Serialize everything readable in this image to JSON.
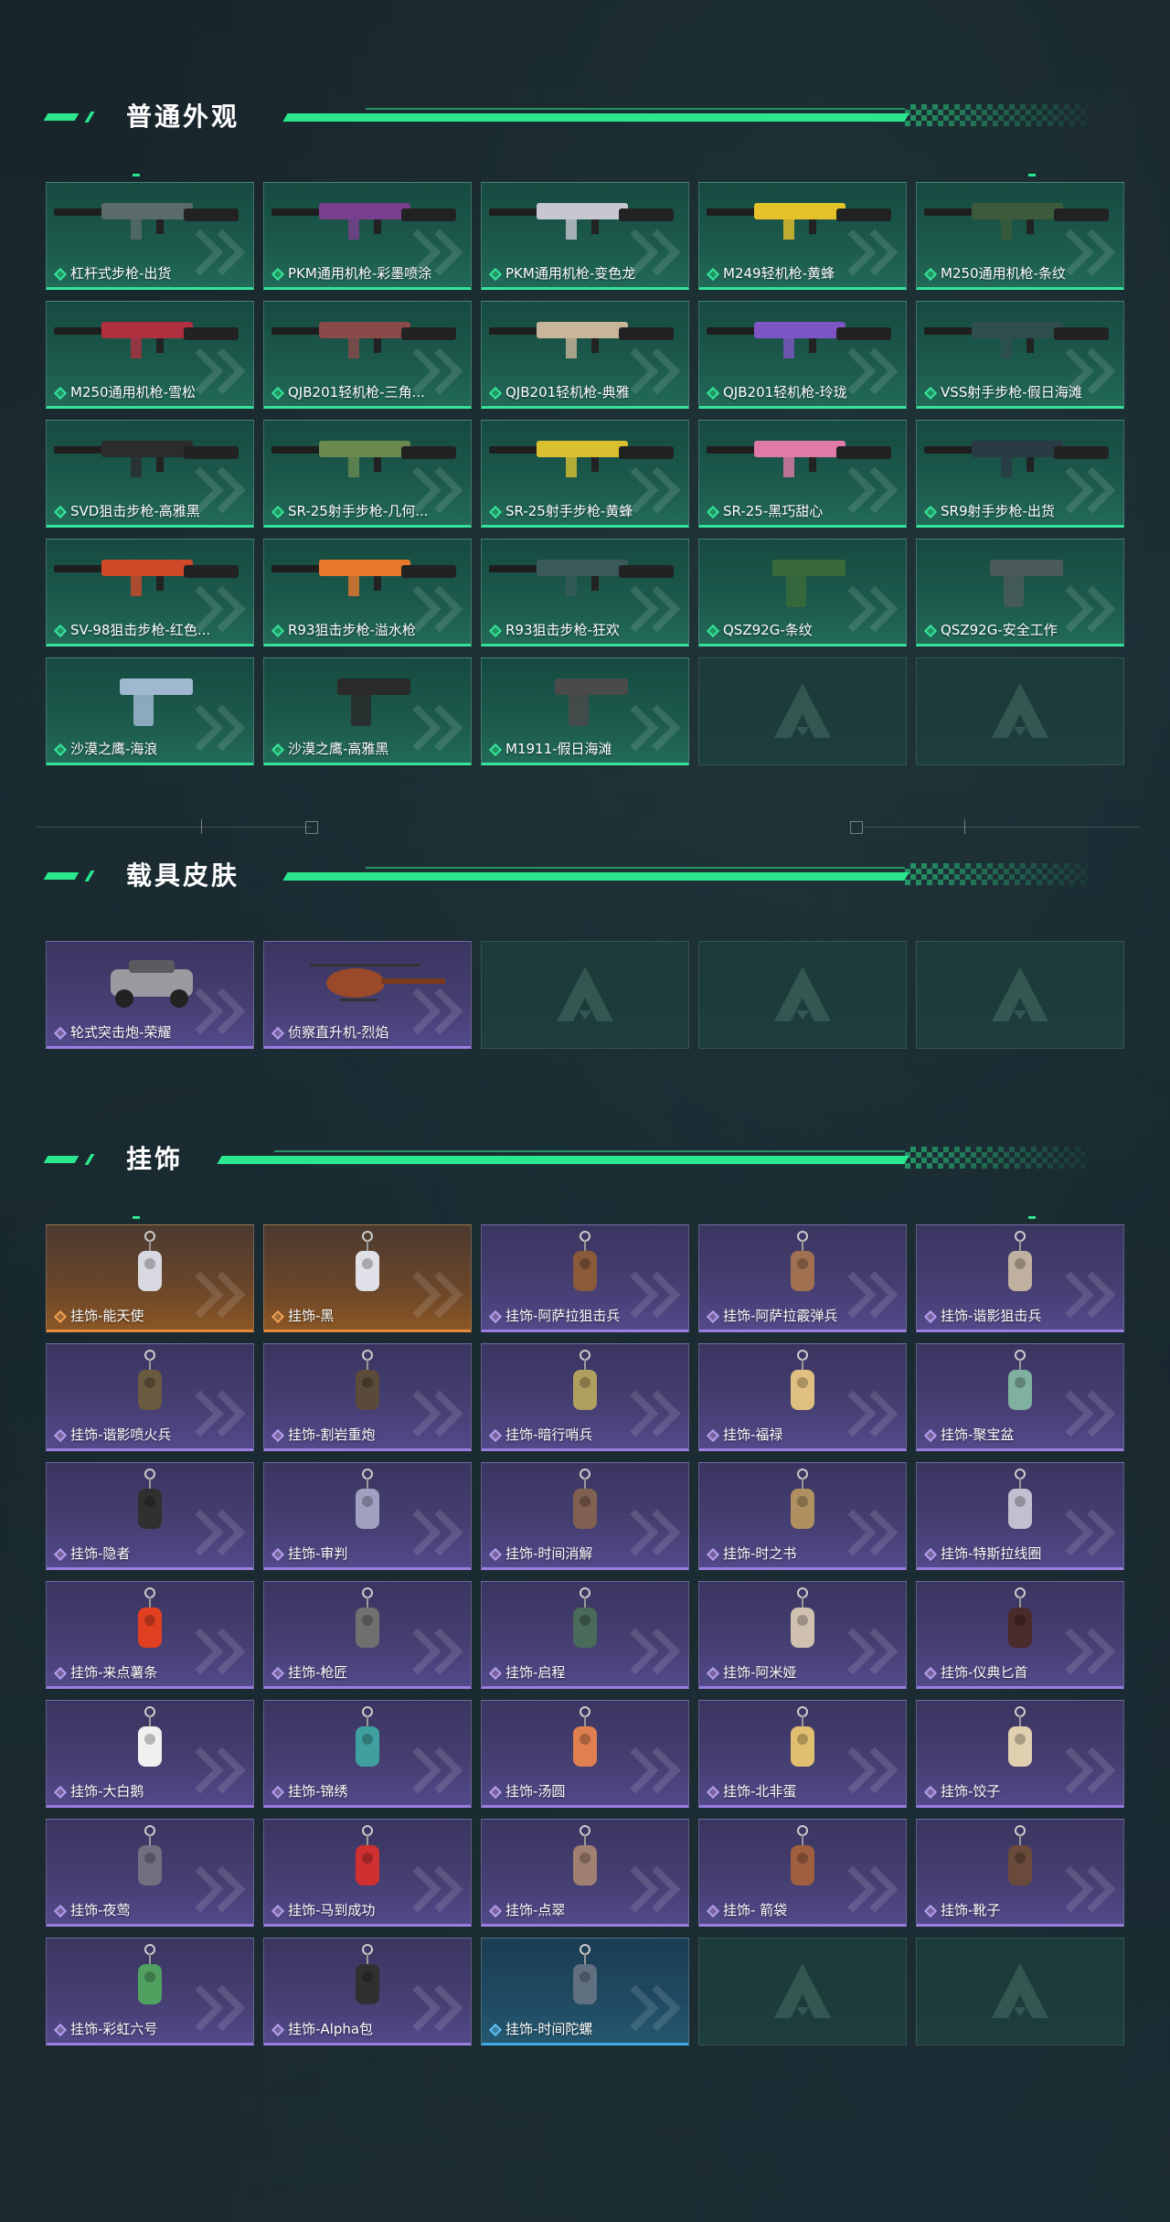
{
  "sections": {
    "normal": {
      "title": "普通外观",
      "items": [
        {
          "label": "杠杆式步枪-出货",
          "rarity": "green"
        },
        {
          "label": "PKM通用机枪-彩墨喷涂",
          "rarity": "green"
        },
        {
          "label": "PKM通用机枪-变色龙",
          "rarity": "green"
        },
        {
          "label": "M249轻机枪-黄蜂",
          "rarity": "green"
        },
        {
          "label": "M250通用机枪-条纹",
          "rarity": "green"
        },
        {
          "label": "M250通用机枪-雪松",
          "rarity": "green"
        },
        {
          "label": "QJB201轻机枪-三角...",
          "rarity": "green"
        },
        {
          "label": "QJB201轻机枪-典雅",
          "rarity": "green"
        },
        {
          "label": "QJB201轻机枪-玲珑",
          "rarity": "green"
        },
        {
          "label": "VSS射手步枪-假日海滩",
          "rarity": "green"
        },
        {
          "label": "SVD狙击步枪-高雅黑",
          "rarity": "green"
        },
        {
          "label": "SR-25射手步枪-几何...",
          "rarity": "green"
        },
        {
          "label": "SR-25射手步枪-黄蜂",
          "rarity": "green"
        },
        {
          "label": "SR-25-黑巧甜心",
          "rarity": "green"
        },
        {
          "label": "SR9射手步枪-出货",
          "rarity": "green"
        },
        {
          "label": "SV-98狙击步枪-红色...",
          "rarity": "green"
        },
        {
          "label": "R93狙击步枪-溢水枪",
          "rarity": "green"
        },
        {
          "label": "R93狙击步枪-狂欢",
          "rarity": "green"
        },
        {
          "label": "QSZ92G-条纹",
          "rarity": "green"
        },
        {
          "label": "QSZ92G-安全工作",
          "rarity": "green"
        },
        {
          "label": "沙漠之鹰-海浪",
          "rarity": "green"
        },
        {
          "label": "沙漠之鹰-高雅黑",
          "rarity": "green"
        },
        {
          "label": "M1911-假日海滩",
          "rarity": "green"
        }
      ],
      "empty_slots": 2
    },
    "vehicle": {
      "title": "载具皮肤",
      "items": [
        {
          "label": "轮式突击炮-荣耀",
          "rarity": "purple"
        },
        {
          "label": "侦察直升机-烈焰",
          "rarity": "purple"
        }
      ],
      "empty_slots": 3
    },
    "charms": {
      "title": "挂饰",
      "items": [
        {
          "label": "挂饰-能天使",
          "rarity": "orange"
        },
        {
          "label": "挂饰-黑",
          "rarity": "orange"
        },
        {
          "label": "挂饰-阿萨拉狙击兵",
          "rarity": "purple"
        },
        {
          "label": "挂饰-阿萨拉霰弹兵",
          "rarity": "purple"
        },
        {
          "label": "挂饰-谐影狙击兵",
          "rarity": "purple"
        },
        {
          "label": "挂饰-谐影喷火兵",
          "rarity": "purple"
        },
        {
          "label": "挂饰-割岩重炮",
          "rarity": "purple"
        },
        {
          "label": "挂饰-暗行哨兵",
          "rarity": "purple"
        },
        {
          "label": "挂饰-福禄",
          "rarity": "purple"
        },
        {
          "label": "挂饰-聚宝盆",
          "rarity": "purple"
        },
        {
          "label": "挂饰-隐者",
          "rarity": "purple"
        },
        {
          "label": "挂饰-审判",
          "rarity": "purple"
        },
        {
          "label": "挂饰-时间消解",
          "rarity": "purple"
        },
        {
          "label": "挂饰-时之书",
          "rarity": "purple"
        },
        {
          "label": "挂饰-特斯拉线圈",
          "rarity": "purple"
        },
        {
          "label": "挂饰-来点薯条",
          "rarity": "purple"
        },
        {
          "label": "挂饰-枪匠",
          "rarity": "purple"
        },
        {
          "label": "挂饰-启程",
          "rarity": "purple"
        },
        {
          "label": "挂饰-阿米娅",
          "rarity": "purple"
        },
        {
          "label": "挂饰-仪典匕首",
          "rarity": "purple"
        },
        {
          "label": "挂饰-大白鹅",
          "rarity": "purple"
        },
        {
          "label": "挂饰-锦绣",
          "rarity": "purple"
        },
        {
          "label": "挂饰-汤圆",
          "rarity": "purple"
        },
        {
          "label": "挂饰-北非蛋",
          "rarity": "purple"
        },
        {
          "label": "挂饰-饺子",
          "rarity": "purple"
        },
        {
          "label": "挂饰-夜莺",
          "rarity": "purple"
        },
        {
          "label": "挂饰-马到成功",
          "rarity": "purple"
        },
        {
          "label": "挂饰-点翠",
          "rarity": "purple"
        },
        {
          "label": "挂饰- 箭袋",
          "rarity": "purple"
        },
        {
          "label": "挂饰-靴子",
          "rarity": "purple"
        },
        {
          "label": "挂饰-彩虹六号",
          "rarity": "purple"
        },
        {
          "label": "挂饰-Alpha包",
          "rarity": "purple"
        },
        {
          "label": "挂饰-时间陀螺",
          "rarity": "blue"
        }
      ],
      "empty_slots": 2
    }
  },
  "colors": {
    "accent": "#2be88e",
    "green_border": "#35e49a",
    "purple_border": "#9b7ee0",
    "orange_border": "#e48a3a",
    "blue_border": "#3ea8e8"
  }
}
